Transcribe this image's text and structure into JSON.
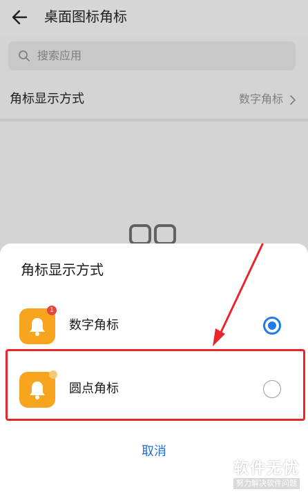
{
  "header": {
    "title": "桌面图标角标"
  },
  "search": {
    "placeholder": "搜索应用"
  },
  "settings_row": {
    "label": "角标显示方式",
    "value": "数字角标"
  },
  "sheet": {
    "title": "角标显示方式",
    "options": [
      {
        "label": "数字角标",
        "badge": "1",
        "selected": true
      },
      {
        "label": "圆点角标",
        "selected": false
      }
    ],
    "cancel_label": "取消"
  },
  "watermark": {
    "main": "软件无忧",
    "sub": "努力解决软件问题"
  },
  "colors": {
    "accent": "#1e7be8",
    "annotation": "#e8262a",
    "app_icon": "#f7a51e"
  },
  "icons": [
    "back-arrow-icon",
    "search-icon",
    "chevron-right-icon",
    "bell-icon",
    "radio-selected-icon",
    "radio-unselected-icon"
  ]
}
